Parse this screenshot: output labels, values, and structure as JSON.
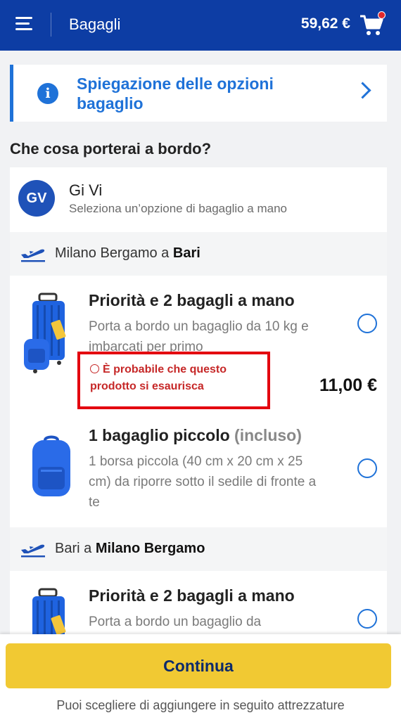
{
  "header": {
    "title": "Bagagli",
    "price": "59,62 €",
    "menu_icon": "hamburger-menu-icon",
    "cart_icon": "shopping-cart-icon"
  },
  "info_card": {
    "text": "Spiegazione delle opzioni bagaglio",
    "icon": "info-icon"
  },
  "section_title": "Che cosa porterai a bordo?",
  "passenger": {
    "initials": "GV",
    "name": "Gi Vi",
    "subtitle": "Seleziona un’opzione di bagaglio a mano"
  },
  "flights": [
    {
      "from": "Milano Bergamo",
      "connector": " a ",
      "to": "Bari",
      "options": [
        {
          "title": "Priorità e 2 bagagli a mano",
          "description": "Porta a bordo un bagaglio da 10 kg e imbarcati per primo",
          "warning": "È probabile che questo prodotto si esaurisca",
          "price": "11,00 €"
        },
        {
          "title": "1 bagaglio piccolo",
          "title_muted": "(incluso)",
          "description": "1 borsa piccola (40 cm x 20 cm x 25 cm) da riporre sotto il sedile di fronte a te"
        }
      ]
    },
    {
      "from": "Bari",
      "connector": " a ",
      "to": "Milano Bergamo",
      "options": [
        {
          "title": "Priorità e 2 bagagli a mano",
          "description": "Porta a bordo un bagaglio da"
        }
      ]
    }
  ],
  "footer": {
    "continue_label": "Continua",
    "note": "Puoi scegliere di aggiungere in seguito attrezzature"
  },
  "colors": {
    "header_bg": "#0d3da4",
    "accent_blue": "#1f72d8",
    "cta_yellow": "#f1c933",
    "warning_red": "#e3000f"
  }
}
